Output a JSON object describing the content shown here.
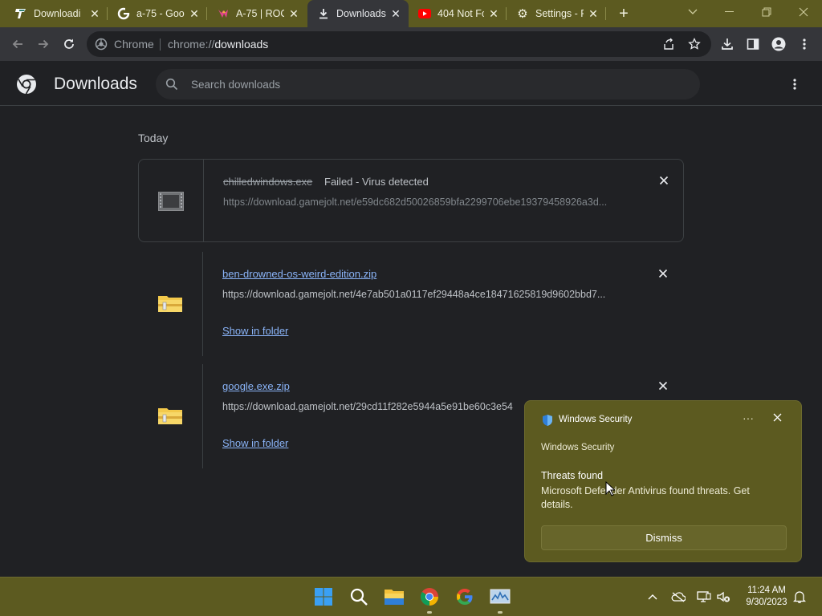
{
  "tabs": [
    {
      "title": "Downloadi",
      "icon": "gamejolt-icon",
      "active": false
    },
    {
      "title": "a-75 - Goo",
      "icon": "google-icon",
      "active": false
    },
    {
      "title": "A-75 | ROO",
      "icon": "roblox-wiki-icon",
      "active": false
    },
    {
      "title": "Downloads",
      "icon": "download-icon",
      "active": true
    },
    {
      "title": "404 Not Fo",
      "icon": "youtube-icon",
      "active": false
    },
    {
      "title": "Settings - P",
      "icon": "gear-icon",
      "active": false
    }
  ],
  "omnibox": {
    "scheme_label": "Chrome",
    "url_prefix": "chrome://",
    "url_host": "downloads"
  },
  "page": {
    "title": "Downloads",
    "search_placeholder": "Search downloads",
    "section": "Today"
  },
  "downloads": [
    {
      "filename": "chilledwindows.exe",
      "status": "Failed - Virus detected",
      "url": "https://download.gamejolt.net/e59dc682d50026859bfa2299706ebe19379458926a3d...",
      "icon": "exe-file-icon",
      "failed": true
    },
    {
      "filename": "ben-drowned-os-weird-edition.zip",
      "url": "https://download.gamejolt.net/4e7ab501a0117ef29448a4ce18471625819d9602bbd7...",
      "action": "Show in folder",
      "icon": "zip-folder-icon"
    },
    {
      "filename": "google.exe.zip",
      "url": "https://download.gamejolt.net/29cd11f282e5944a5e91be60c3e54",
      "action": "Show in folder",
      "icon": "zip-folder-icon"
    }
  ],
  "toast": {
    "app": "Windows Security",
    "subtitle": "Windows Security",
    "heading": "Threats found",
    "body": "Microsoft Defender Antivirus found threats. Get details.",
    "button": "Dismiss"
  },
  "taskbar": {
    "time": "11:24 AM",
    "date": "9/30/2023"
  },
  "colors": {
    "titlebar": "#5c5a20",
    "toolbar": "#35363a",
    "page": "#202124",
    "link": "#8ab4f8"
  }
}
